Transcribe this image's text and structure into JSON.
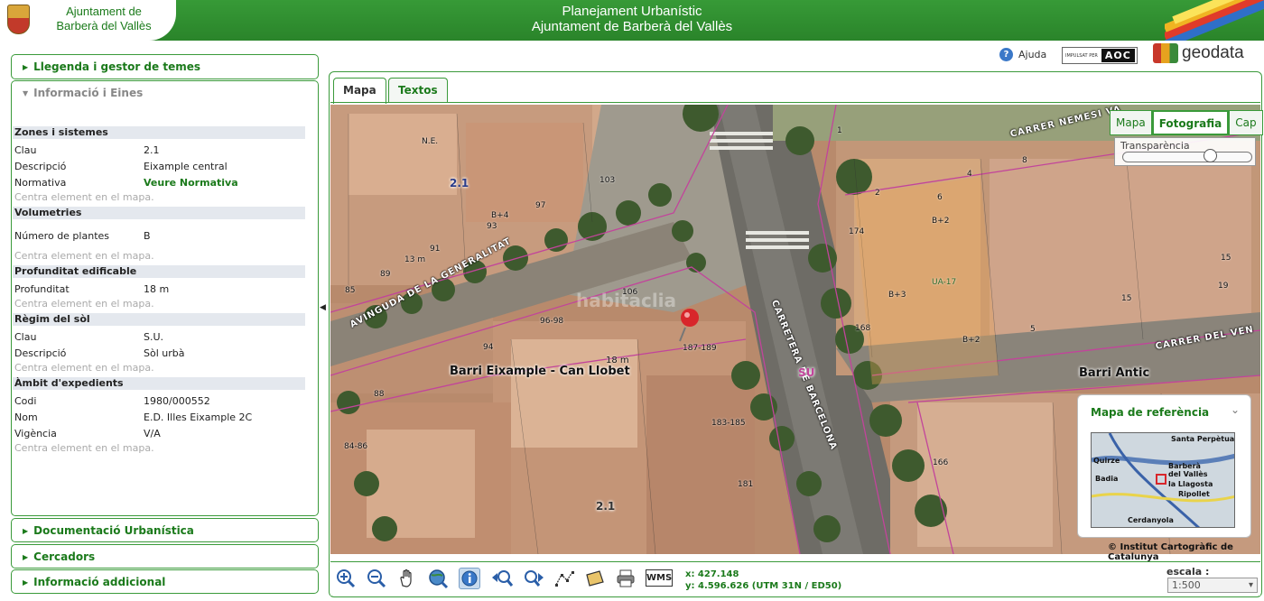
{
  "header": {
    "logo_line1": "Ajuntament de",
    "logo_line2": "Barberà del Vallès",
    "title_line1": "Planejament Urbanístic",
    "title_line2": "Ajuntament de Barberà del Vallès"
  },
  "topbar": {
    "help_label": "Ajuda",
    "aoc_small": "IMPULSAT PER",
    "aoc_logo": "AOC",
    "geodata_label": "geodata"
  },
  "left_panel": {
    "legend": "Llegenda i gestor de temes",
    "info_tools": "Informació i Eines",
    "centra": "Centra element en el mapa.",
    "sections": {
      "zones": {
        "title": "Zones i sistemes",
        "rows": [
          {
            "k": "Clau",
            "v": "2.1"
          },
          {
            "k": "Descripció",
            "v": "Eixample central"
          },
          {
            "k": "Normativa",
            "v": "Veure Normativa"
          }
        ]
      },
      "volumetries": {
        "title": "Volumetries",
        "rows": [
          {
            "k": "Número de plantes",
            "v": "B"
          }
        ]
      },
      "profunditat": {
        "title": "Profunditat edificable",
        "rows": [
          {
            "k": "Profunditat",
            "v": "18 m"
          }
        ]
      },
      "regim": {
        "title": "Règim del sòl",
        "rows": [
          {
            "k": "Clau",
            "v": "S.U."
          },
          {
            "k": "Descripció",
            "v": "Sòl urbà"
          }
        ]
      },
      "ambit": {
        "title": "Àmbit d'expedients",
        "rows": [
          {
            "k": "Codi",
            "v": "1980/000552"
          },
          {
            "k": "Nom",
            "v": "E.D. Illes Eixample 2C"
          },
          {
            "k": "Vigència",
            "v": "V/A"
          }
        ]
      }
    },
    "doc_urbanistica": "Documentació Urbanística",
    "cercadors": "Cercadors",
    "info_addicional": "Informació addicional"
  },
  "map_tabs": [
    {
      "label": "Mapa",
      "active": true
    },
    {
      "label": "Textos",
      "active": false
    }
  ],
  "layer_switch": {
    "mapa": "Mapa",
    "fotografia": "Fotografia",
    "cap": "Cap",
    "transparency": "Transparència",
    "transparency_level": 0.7
  },
  "map_labels": {
    "barri1": "Barri Eixample - Can Llobet",
    "barri2": "Barri Antic",
    "street1": "AVINGUDA DE LA GENERALITAT",
    "street2": "CARRETERA DE BARCELONA",
    "street3": "CARRER NEMESI VA",
    "street4": "CARRER DEL VEN",
    "zone_21a": "2.1",
    "zone_21b": "2.1",
    "su": "SU",
    "watermark": "habitaclia",
    "m18": "18 m",
    "m13": "13 m",
    "ne": "N.E.",
    "bp4": "B+4",
    "bp2": "B+2",
    "bp3": "B+3",
    "bp2b": "B+2",
    "ua": "UA-17",
    "num_parcel_main": "187-189",
    "nums": [
      "103",
      "97",
      "93",
      "91",
      "89",
      "85",
      "106",
      "96-98",
      "94",
      "88",
      "84-86",
      "183-185",
      "181",
      "174",
      "168",
      "166",
      "1",
      "2",
      "4",
      "6",
      "8",
      "15",
      "5",
      "19",
      "15"
    ]
  },
  "ref_map": {
    "title": "Mapa de referència",
    "places": [
      "Santa Perpètua",
      "Quirze",
      "Barberà",
      "del Vallès",
      "Badia",
      "la Llagosta",
      "Ripollet",
      "Cerdanyola"
    ]
  },
  "copyright": "© Institut Cartogràfic de Catalunya",
  "toolbar": {
    "wms": "WMS",
    "coord_x": "x: 427.148",
    "coord_y": "y: 4.596.626 (UTM 31N / ED50)",
    "escala_label": "escala :",
    "escala_value": "1:500"
  },
  "colors": {
    "brand_green": "#2f8f2f",
    "link_green": "#1b7a1b",
    "parcel_line": "#c2449b"
  }
}
